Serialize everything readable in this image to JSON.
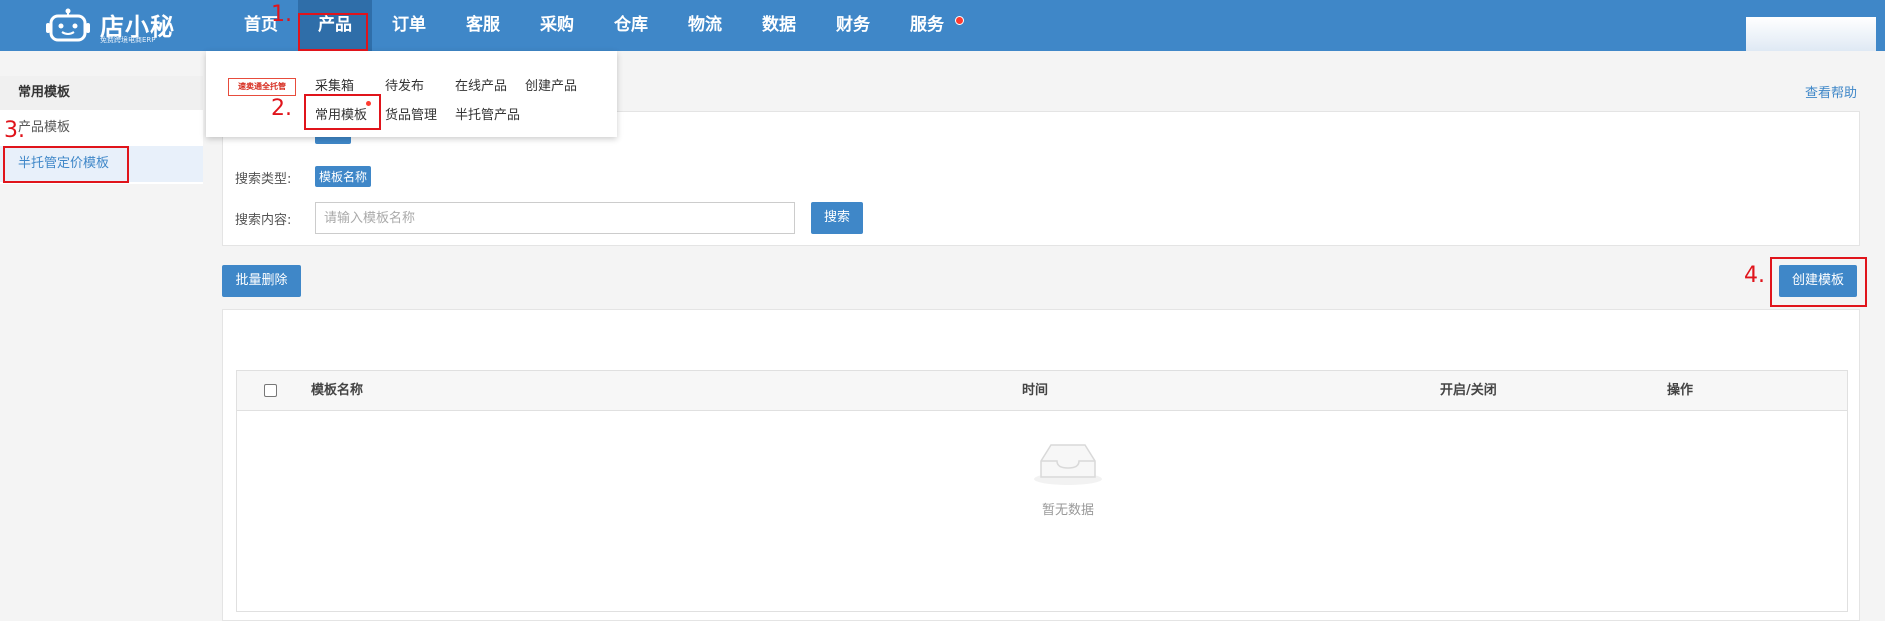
{
  "brand": {
    "name": "店小秘",
    "slogan": "免费跨境电商ERP"
  },
  "nav": {
    "items": [
      {
        "label": "首页"
      },
      {
        "label": "产品"
      },
      {
        "label": "订单"
      },
      {
        "label": "客服"
      },
      {
        "label": "采购"
      },
      {
        "label": "仓库"
      },
      {
        "label": "物流"
      },
      {
        "label": "数据"
      },
      {
        "label": "财务"
      },
      {
        "label": "服务"
      }
    ],
    "active": "产品"
  },
  "dropdown": {
    "badge": "速卖通全托管",
    "links": [
      "采集箱",
      "待发布",
      "在线产品",
      "创建产品",
      "常用模板",
      "货品管理",
      "半托管产品"
    ]
  },
  "sidebar": {
    "header": "常用模板",
    "items": [
      {
        "label": "产品模板"
      },
      {
        "label": "半托管定价模板"
      }
    ],
    "active": "半托管定价模板"
  },
  "help": {
    "label": "查看帮助"
  },
  "search": {
    "type_label": "搜索类型:",
    "type_tag": "模板名称",
    "content_label": "搜索内容:",
    "placeholder": "请输入模板名称",
    "value": "",
    "button": "搜索"
  },
  "toolbar": {
    "batch_delete": "批量删除",
    "create_template": "创建模板"
  },
  "table": {
    "columns": [
      "模板名称",
      "时间",
      "开启/关闭",
      "操作"
    ],
    "rows": [],
    "empty_text": "暂无数据"
  },
  "annotations": [
    "1.",
    "2.",
    "3.",
    "4."
  ],
  "colors": {
    "primary": "#3f87c8",
    "annotation": "#e0141b",
    "nav_active": "#2f6ea9"
  }
}
